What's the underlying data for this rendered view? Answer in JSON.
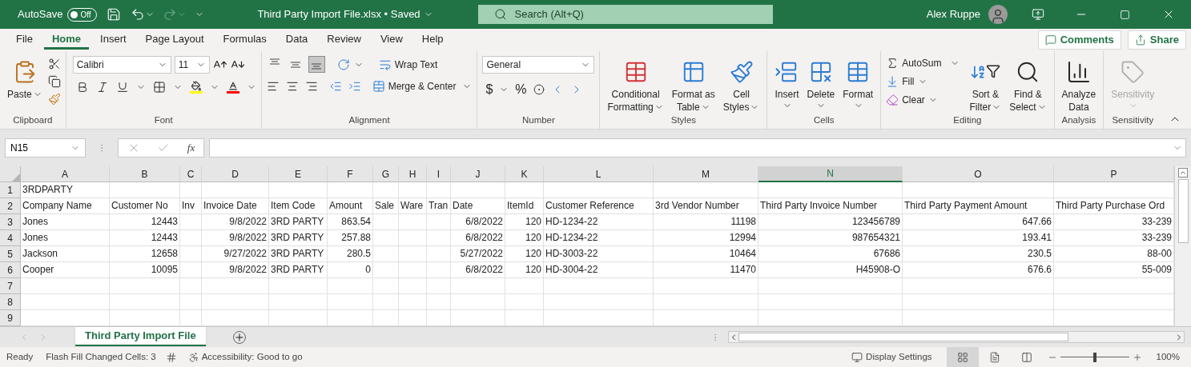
{
  "title_bar": {
    "autosave_label": "AutoSave",
    "autosave_on": false,
    "autosave_state": "Off",
    "document_title": "Third Party Import File.xlsx • Saved",
    "search_placeholder": "Search (Alt+Q)",
    "user_name": "Alex Ruppe"
  },
  "menu_tabs": [
    {
      "label": "File",
      "selected": false
    },
    {
      "label": "Home",
      "selected": true
    },
    {
      "label": "Insert",
      "selected": false
    },
    {
      "label": "Page Layout",
      "selected": false
    },
    {
      "label": "Formulas",
      "selected": false
    },
    {
      "label": "Data",
      "selected": false
    },
    {
      "label": "Review",
      "selected": false
    },
    {
      "label": "View",
      "selected": false
    },
    {
      "label": "Help",
      "selected": false
    }
  ],
  "actions": [
    "Comments",
    "Share"
  ],
  "ribbon": {
    "clipboard": {
      "label": "Clipboard",
      "paste": "Paste"
    },
    "font": {
      "label": "Font",
      "font_name": "Calibri",
      "font_size": "11"
    },
    "alignment": {
      "label": "Alignment",
      "vertical": [
        {
          "selected": false
        },
        {
          "selected": false
        },
        {
          "selected": true
        }
      ],
      "wrap_text": "Wrap Text",
      "merge": "Merge & Center"
    },
    "number": {
      "label": "Number",
      "format": "General",
      "currency": "$",
      "percent": "%"
    },
    "styles": {
      "label": "Styles",
      "buttons": [
        {
          "lines": [
            "Conditional",
            "Formatting"
          ]
        },
        {
          "lines": [
            "Format as",
            "Table"
          ]
        },
        {
          "lines": [
            "Cell",
            "Styles"
          ]
        }
      ]
    },
    "cells": {
      "label": "Cells",
      "buttons": [
        "Insert",
        "Delete",
        "Format"
      ]
    },
    "editing": {
      "label": "Editing",
      "autosum": "AutoSum",
      "fill": "Fill",
      "clear": "Clear",
      "sort": [
        "Sort &",
        "Filter"
      ],
      "find": [
        "Find &",
        "Select"
      ]
    },
    "analysis": {
      "label": "Analysis",
      "button": [
        "Analyze",
        "Data"
      ]
    },
    "sensitivity": {
      "label": "Sensitivity",
      "button": "Sensitivity",
      "disabled": true
    }
  },
  "formula_bar": {
    "name_box": "N15",
    "function_label": "fx"
  },
  "sheet": {
    "columns": [
      {
        "letter": "A",
        "selected": false
      },
      {
        "letter": "B",
        "selected": false
      },
      {
        "letter": "C",
        "selected": false
      },
      {
        "letter": "D",
        "selected": false
      },
      {
        "letter": "E",
        "selected": false
      },
      {
        "letter": "F",
        "selected": false
      },
      {
        "letter": "G",
        "selected": false
      },
      {
        "letter": "H",
        "selected": false
      },
      {
        "letter": "I",
        "selected": false
      },
      {
        "letter": "J",
        "selected": false
      },
      {
        "letter": "K",
        "selected": false
      },
      {
        "letter": "L",
        "selected": false
      },
      {
        "letter": "M",
        "selected": false
      },
      {
        "letter": "N",
        "selected": true
      },
      {
        "letter": "O",
        "selected": false
      },
      {
        "letter": "P",
        "selected": false
      }
    ],
    "rows": [
      {
        "number": "1",
        "cells": [
          {
            "value": "3RDPARTY",
            "numeric": false
          }
        ]
      },
      {
        "number": "2",
        "cells": [
          {
            "value": "Company Name",
            "numeric": false
          },
          {
            "value": "Customer No",
            "numeric": false
          },
          {
            "value": "Inv",
            "numeric": false
          },
          {
            "value": "Invoice Date",
            "numeric": false
          },
          {
            "value": "Item Code",
            "numeric": false
          },
          {
            "value": "Amount",
            "numeric": false
          },
          {
            "value": "Sale",
            "numeric": false
          },
          {
            "value": "Ware",
            "numeric": false
          },
          {
            "value": "Tran",
            "numeric": false
          },
          {
            "value": "Date",
            "numeric": false
          },
          {
            "value": "ItemId",
            "numeric": false
          },
          {
            "value": "Customer Reference",
            "numeric": false
          },
          {
            "value": "3rd Vendor Number",
            "numeric": false
          },
          {
            "value": "Third Party Invoice Number",
            "numeric": false
          },
          {
            "value": "Third Party Payment Amount",
            "numeric": false
          },
          {
            "value": "Third Party Purchase Ord",
            "numeric": false
          }
        ]
      },
      {
        "number": "3",
        "cells": [
          {
            "value": "Jones",
            "numeric": false
          },
          {
            "value": "12443",
            "numeric": true
          },
          null,
          {
            "value": "9/8/2022",
            "numeric": true
          },
          {
            "value": "3RD PARTY",
            "numeric": false
          },
          {
            "value": "863.54",
            "numeric": true
          },
          null,
          null,
          null,
          {
            "value": "6/8/2022",
            "numeric": true
          },
          {
            "value": "120",
            "numeric": true
          },
          {
            "value": "HD-1234-22",
            "numeric": false
          },
          {
            "value": "11198",
            "numeric": true
          },
          {
            "value": "123456789",
            "numeric": true
          },
          {
            "value": "647.66",
            "numeric": true
          },
          {
            "value": "33-239",
            "numeric": true
          }
        ]
      },
      {
        "number": "4",
        "cells": [
          {
            "value": "Jones",
            "numeric": false
          },
          {
            "value": "12443",
            "numeric": true
          },
          null,
          {
            "value": "9/8/2022",
            "numeric": true
          },
          {
            "value": "3RD PARTY",
            "numeric": false
          },
          {
            "value": "257.88",
            "numeric": true
          },
          null,
          null,
          null,
          {
            "value": "6/8/2022",
            "numeric": true
          },
          {
            "value": "120",
            "numeric": true
          },
          {
            "value": "HD-1234-22",
            "numeric": false
          },
          {
            "value": "12994",
            "numeric": true
          },
          {
            "value": "987654321",
            "numeric": true
          },
          {
            "value": "193.41",
            "numeric": true
          },
          {
            "value": "33-239",
            "numeric": true
          }
        ]
      },
      {
        "number": "5",
        "cells": [
          {
            "value": "Jackson",
            "numeric": false
          },
          {
            "value": "12658",
            "numeric": true
          },
          null,
          {
            "value": "9/27/2022",
            "numeric": true
          },
          {
            "value": "3RD PARTY",
            "numeric": false
          },
          {
            "value": "280.5",
            "numeric": true
          },
          null,
          null,
          null,
          {
            "value": "5/27/2022",
            "numeric": true
          },
          {
            "value": "120",
            "numeric": true
          },
          {
            "value": "HD-3003-22",
            "numeric": false
          },
          {
            "value": "10464",
            "numeric": true
          },
          {
            "value": "67686",
            "numeric": true
          },
          {
            "value": "230.5",
            "numeric": true
          },
          {
            "value": "88-00",
            "numeric": true
          }
        ]
      },
      {
        "number": "6",
        "cells": [
          {
            "value": "Cooper",
            "numeric": false
          },
          {
            "value": "10095",
            "numeric": true
          },
          null,
          {
            "value": "9/8/2022",
            "numeric": true
          },
          {
            "value": "3RD PARTY",
            "numeric": false
          },
          {
            "value": "0",
            "numeric": true
          },
          null,
          null,
          null,
          {
            "value": "6/8/2022",
            "numeric": true
          },
          {
            "value": "120",
            "numeric": true
          },
          {
            "value": "HD-3004-22",
            "numeric": false
          },
          {
            "value": "11470",
            "numeric": true
          },
          {
            "value": "H45908-O",
            "numeric": true
          },
          {
            "value": "676.6",
            "numeric": true
          },
          {
            "value": "55-009",
            "numeric": true
          }
        ]
      },
      {
        "number": "7"
      },
      {
        "number": "8"
      },
      {
        "number": "9"
      }
    ]
  },
  "sheet_tabs": [
    {
      "label": "Third Party Import File",
      "selected": true
    }
  ],
  "status_bar": {
    "mode": "Ready",
    "flash_fill": "Flash Fill Changed Cells: 3",
    "accessibility": "Accessibility: Good to go",
    "display_settings": "Display Settings",
    "views": [
      {
        "selected": true
      },
      {
        "selected": false
      },
      {
        "selected": false
      }
    ],
    "zoom": {
      "level": 0.5
    },
    "zoom_label": "100%"
  }
}
